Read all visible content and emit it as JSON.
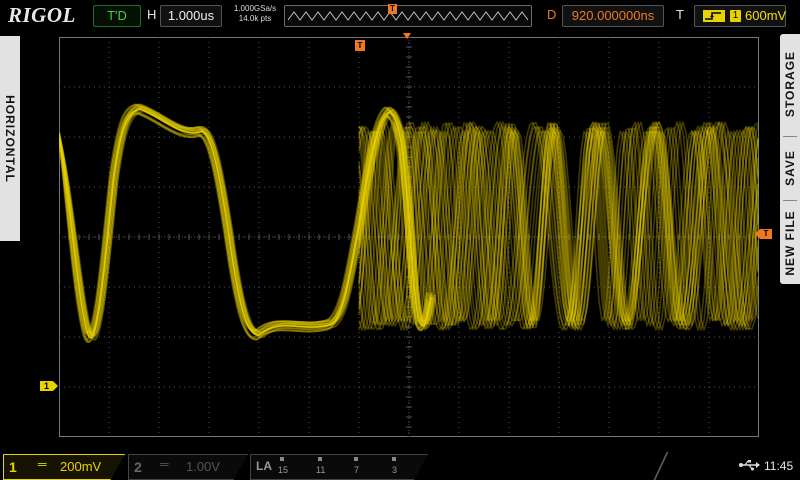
{
  "brand": {
    "logo": "RIGOL"
  },
  "top": {
    "status": "T'D",
    "h_label": "H",
    "timebase": "1.000us",
    "sample_rate": "1.000GSa/s",
    "mem_depth": "14.0k pts",
    "trig_marker": "T",
    "d_label": "D",
    "delay": "920.000000ns",
    "t_label": "T",
    "trig_channel": "1",
    "trig_level": "600mV"
  },
  "left_tab": {
    "label": "HORIZONTAL"
  },
  "right_tab": {
    "items": [
      "STORAGE",
      "SAVE",
      "NEW FILE"
    ]
  },
  "markers": {
    "ch1": "1",
    "trig_pos": "T",
    "trig_level": "T"
  },
  "bottom": {
    "ch1": {
      "num": "1",
      "coupling": "═",
      "scale": "200mV"
    },
    "ch2": {
      "num": "2",
      "coupling": "═",
      "scale": "1.00V"
    },
    "la": {
      "label": "LA",
      "ticks": [
        "15",
        "11",
        "7",
        "3"
      ]
    },
    "clock": "11:45"
  },
  "colors": {
    "ch1": "#e8d200",
    "trigger": "#f07820",
    "status": "#3fd13f",
    "grid": "#505050"
  },
  "icons": {
    "usb": "usb-icon",
    "edge": "rising-edge-icon"
  }
}
